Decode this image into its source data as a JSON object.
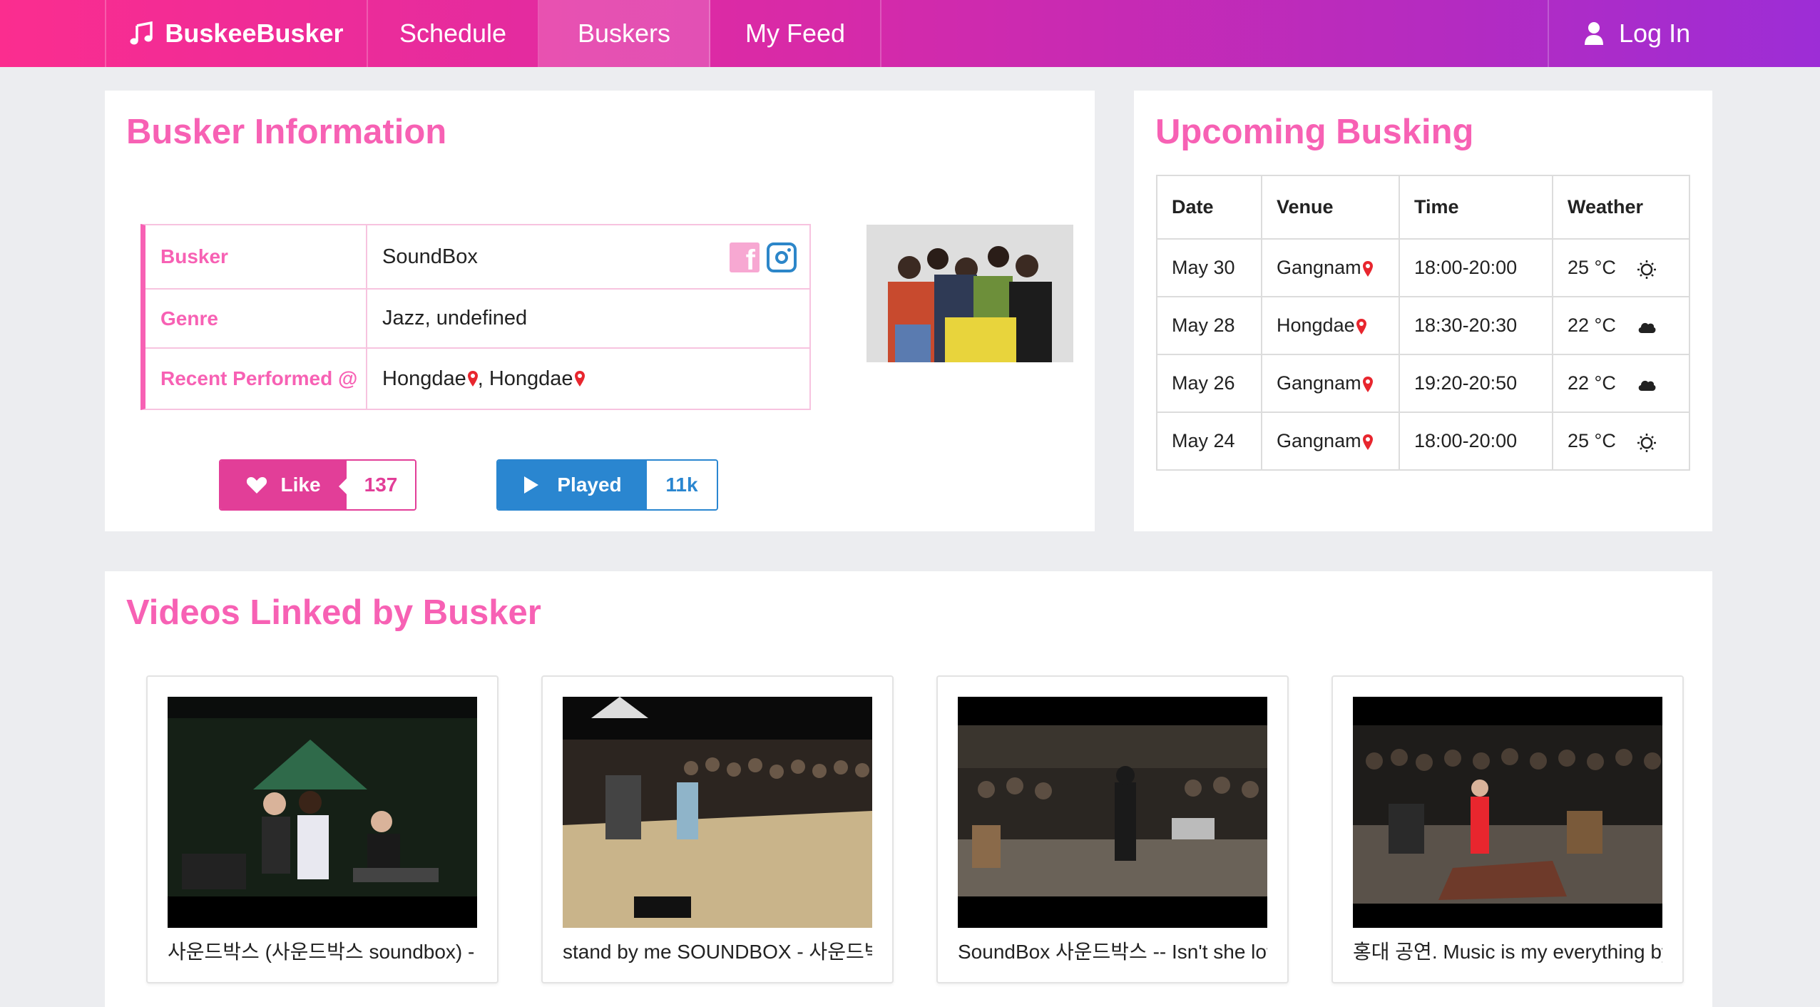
{
  "nav": {
    "brand": "BuskeeBusker",
    "schedule": "Schedule",
    "buskers": "Buskers",
    "feed": "My Feed",
    "login": "Log In"
  },
  "busker_info": {
    "title": "Busker Information",
    "rows": [
      {
        "label": "Busker",
        "value": "SoundBox"
      },
      {
        "label": "Genre",
        "value": "Jazz, undefined"
      },
      {
        "label": "Recent Performed @",
        "venues": [
          "Hongdae",
          "Hongdae"
        ]
      }
    ],
    "like": {
      "label": "Like",
      "count": "137"
    },
    "played": {
      "label": "Played",
      "count": "11k"
    }
  },
  "upcoming": {
    "title": "Upcoming Busking",
    "headers": [
      "Date",
      "Venue",
      "Time",
      "Weather"
    ],
    "rows": [
      {
        "date": "May 30",
        "venue": "Gangnam",
        "time": "18:00-20:00",
        "temp": "25 °C",
        "weather_icon": "sun-icon"
      },
      {
        "date": "May 28",
        "venue": "Hongdae",
        "time": "18:30-20:30",
        "temp": "22 °C",
        "weather_icon": "cloud-icon"
      },
      {
        "date": "May 26",
        "venue": "Gangnam",
        "time": "19:20-20:50",
        "temp": "22 °C",
        "weather_icon": "cloud-icon"
      },
      {
        "date": "May 24",
        "venue": "Gangnam",
        "time": "18:00-20:00",
        "temp": "25 °C",
        "weather_icon": "sun-icon"
      }
    ]
  },
  "videos": {
    "title": "Videos Linked by Busker",
    "items": [
      {
        "title": "사운드박스 (사운드박스 soundbox) - le"
      },
      {
        "title": "stand by me SOUNDBOX - 사운드박:"
      },
      {
        "title": "SoundBox 사운드박스 -- Isn't she love"
      },
      {
        "title": "홍대 공연. Music is my everything by"
      }
    ]
  },
  "colors": {
    "accent_pink": "#f761b4",
    "like_pink": "#e23e98",
    "played_blue": "#2a86d0",
    "pin_red": "#e8262e"
  }
}
